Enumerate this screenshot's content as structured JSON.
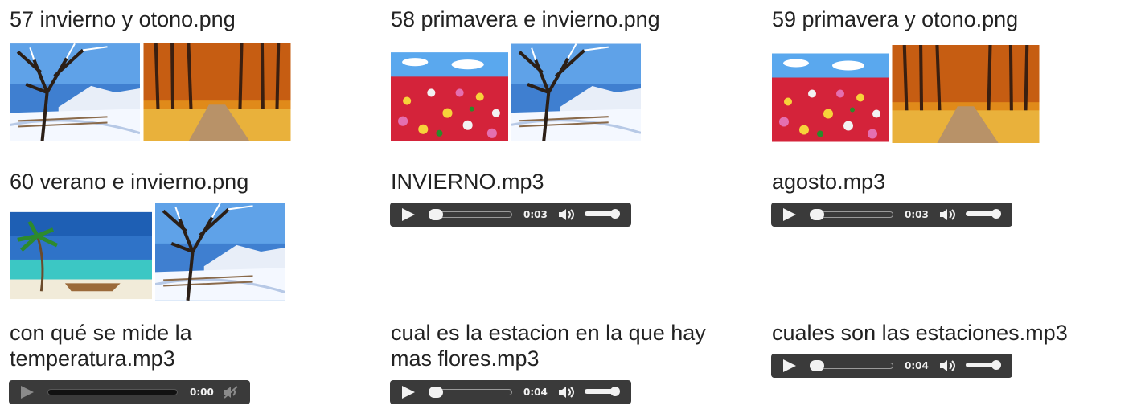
{
  "items": [
    {
      "title": "57 invierno y otono.png",
      "images": [
        "winter-scene",
        "autumn-scene"
      ]
    },
    {
      "title": "58 primavera e invierno.png",
      "images": [
        "flower-field",
        "winter-scene"
      ]
    },
    {
      "title": "59 primavera y otono.png",
      "images": [
        "flower-field",
        "autumn-scene"
      ]
    },
    {
      "title": "60 verano e invierno.png",
      "images": [
        "beach-scene",
        "winter-scene"
      ]
    },
    {
      "title": "INVIERNO.mp3",
      "player": {
        "time": "0:03",
        "state": "ready"
      }
    },
    {
      "title": "agosto.mp3",
      "player": {
        "time": "0:03",
        "state": "ready"
      }
    },
    {
      "title": "con qué se mide la temperatura.mp3",
      "player": {
        "time": "0:00",
        "state": "unavailable"
      }
    },
    {
      "title": "cual es la estacion en la que hay mas flores.mp3",
      "player": {
        "time": "0:04",
        "state": "ready"
      }
    },
    {
      "title": "cuales son las estaciones.mp3",
      "player": {
        "time": "0:04",
        "state": "ready"
      }
    }
  ],
  "colors": {
    "player_bg": "#3a3a3a",
    "text": "#222222"
  }
}
